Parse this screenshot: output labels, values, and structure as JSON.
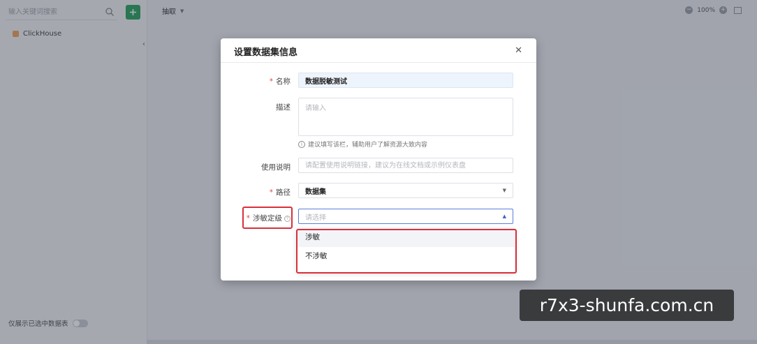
{
  "sidebar": {
    "search_placeholder": "输入关键词搜索",
    "tree_item": "ClickHouse",
    "toggle_label": "仅展示已选中数据表"
  },
  "topbar": {
    "tab_label": "抽取",
    "zoom": "100%"
  },
  "dialog": {
    "title": "设置数据集信息",
    "name_label": "名称",
    "name_value": "数据脱敏测试",
    "desc_label": "描述",
    "desc_placeholder": "请输入",
    "desc_hint": "建议填写该栏，辅助用户了解资源大致内容",
    "usage_label": "使用说明",
    "usage_placeholder": "请配置使用说明链接，建议为在线文档或示例仪表盘",
    "path_label": "路径",
    "path_value": "数据集",
    "sensitivity_label": "涉敏定级",
    "sensitivity_placeholder": "请选择",
    "options": [
      "涉敏",
      "不涉敏"
    ]
  },
  "watermark": "r7x3-shunfa.com.cn"
}
